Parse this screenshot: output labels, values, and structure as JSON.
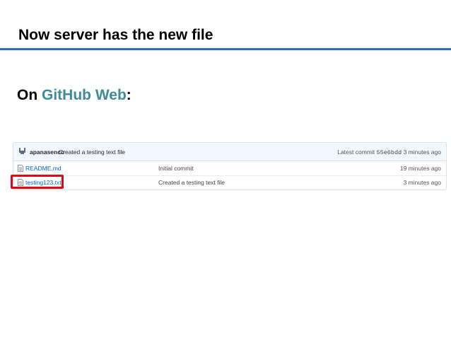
{
  "slide": {
    "title": "Now server has the new file",
    "subtitle_prefix": "On ",
    "subtitle_accent": "GitHub Web",
    "subtitle_suffix": ":"
  },
  "colors": {
    "title_rule": "#2e6fb7",
    "accent_text": "#3d8b9a",
    "link": "#0366d6",
    "highlight": "#e30613",
    "header_bg": "#f1f8ff"
  },
  "repo": {
    "last_commit": {
      "avatar_icon": "user-avatar-icon",
      "author": "apanasenco",
      "message": "Created a testing text file",
      "latest_label": "Latest commit",
      "sha": "55e6bdd",
      "age": "3 minutes ago"
    },
    "files": [
      {
        "icon": "file-text-icon",
        "name": "README.md",
        "commit_message": "Initial commit",
        "age": "19 minutes ago",
        "highlighted": false
      },
      {
        "icon": "file-text-icon",
        "name": "testing123.txt",
        "commit_message": "Created a testing text file",
        "age": "3 minutes ago",
        "highlighted": true
      }
    ]
  }
}
